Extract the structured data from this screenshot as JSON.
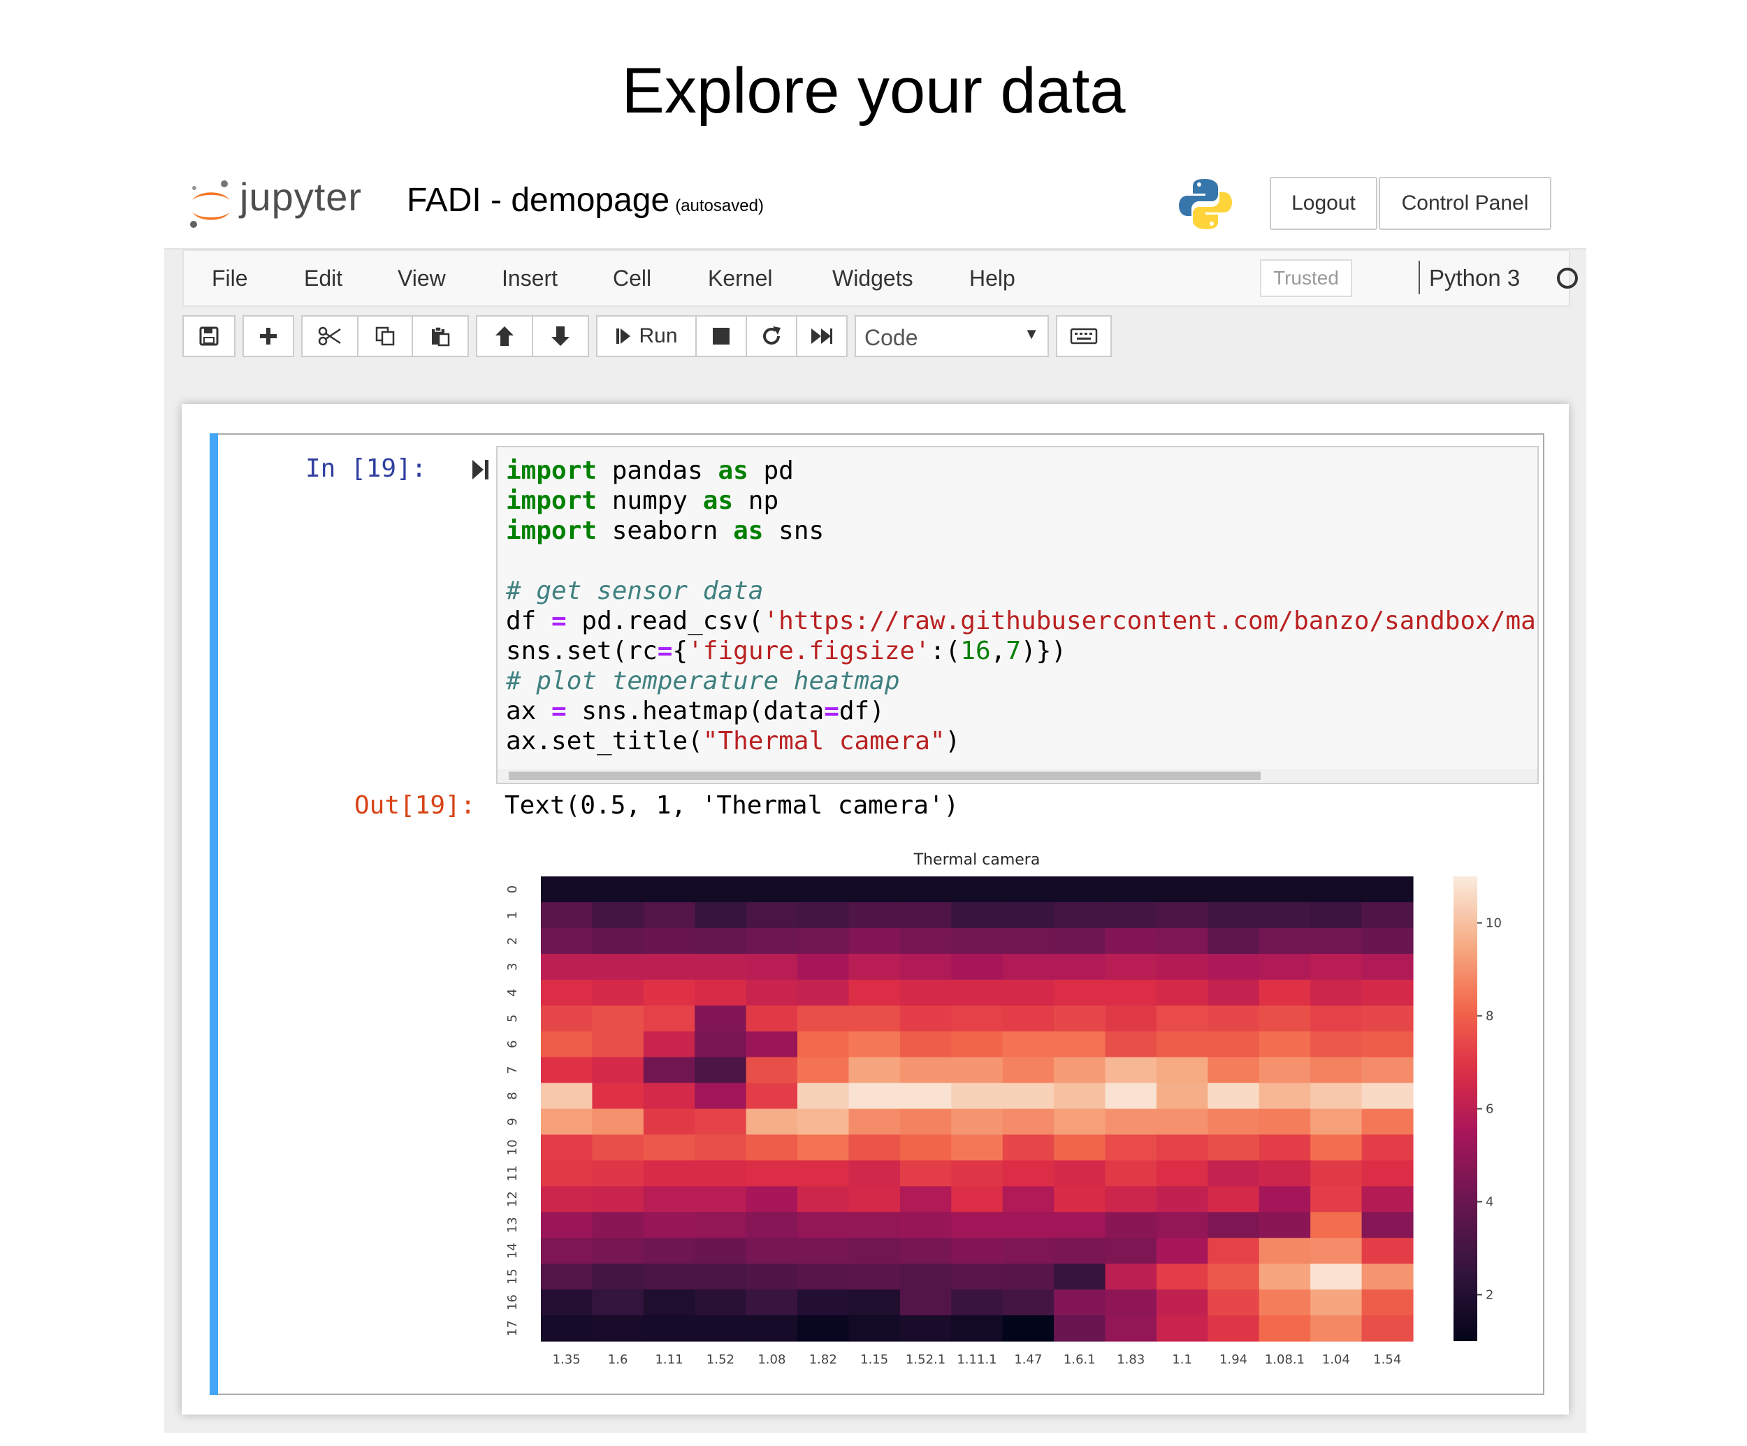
{
  "slide_title": "Explore your data",
  "header": {
    "logo_text": "jupyter",
    "notebook_name": "FADI - demopage",
    "autosave_status": "(autosaved)",
    "logout_label": "Logout",
    "control_panel_label": "Control Panel"
  },
  "menubar": {
    "items": [
      "File",
      "Edit",
      "View",
      "Insert",
      "Cell",
      "Kernel",
      "Widgets",
      "Help"
    ],
    "trusted_label": "Trusted",
    "kernel_name": "Python 3"
  },
  "toolbar": {
    "run_label": "Run",
    "cell_type": "Code"
  },
  "cell": {
    "in_prompt": "In [19]:",
    "out_prompt": "Out[19]:",
    "output_text": "Text(0.5, 1, 'Thermal camera')",
    "code": {
      "l1_kw": "import",
      "l1_mod": " pandas ",
      "l1_as": "as",
      "l1_alias": " pd",
      "l2_kw": "import",
      "l2_mod": " numpy ",
      "l2_as": "as",
      "l2_alias": " np",
      "l3_kw": "import",
      "l3_mod": " seaborn ",
      "l3_as": "as",
      "l3_alias": " sns",
      "c1": "# get sensor data",
      "l5_a": "df ",
      "l5_op": "=",
      "l5_b": " pd.read_csv(",
      "l5_str": "'https://raw.githubusercontent.com/banzo/sandbox/ma",
      "l6_a": "sns.set(rc",
      "l6_op": "=",
      "l6_b": "{",
      "l6_str": "'figure.figsize'",
      "l6_c": ":(",
      "l6_n1": "16",
      "l6_d": ",",
      "l6_n2": "7",
      "l6_e": ")})",
      "c2": "# plot temperature heatmap",
      "l8_a": "ax ",
      "l8_op": "=",
      "l8_b": " sns.heatmap(data",
      "l8_op2": "=",
      "l8_c": "df)",
      "l9_a": "ax.set_title(",
      "l9_str": "\"Thermal camera\"",
      "l9_b": ")"
    }
  },
  "chart_data": {
    "type": "heatmap",
    "title": "Thermal camera",
    "x_tick_labels": [
      "1.35",
      "1.6",
      "1.11",
      "1.52",
      "1.08",
      "1.82",
      "1.15",
      "1.52.1",
      "1.11.1",
      "1.47",
      "1.6.1",
      "1.83",
      "1.1",
      "1.94",
      "1.08.1",
      "1.04",
      "1.54"
    ],
    "y_tick_labels": [
      "0",
      "1",
      "2",
      "3",
      "4",
      "5",
      "6",
      "7",
      "8",
      "9",
      "10",
      "11",
      "12",
      "13",
      "14",
      "15",
      "16",
      "17"
    ],
    "colorbar_ticks": [
      2,
      4,
      6,
      8,
      10
    ],
    "vmin": 1,
    "vmax": 11,
    "colormap": "rocket",
    "values": [
      [
        1.5,
        1.5,
        1.5,
        1.5,
        1.5,
        1.5,
        1.5,
        1.5,
        1.5,
        1.5,
        1.5,
        1.5,
        1.5,
        1.5,
        1.5,
        1.5,
        1.5
      ],
      [
        3.6,
        3.0,
        3.4,
        2.6,
        3.1,
        3.0,
        3.3,
        3.3,
        2.7,
        2.7,
        3.0,
        3.0,
        3.2,
        2.9,
        2.9,
        2.8,
        3.3
      ],
      [
        4.1,
        3.8,
        4.0,
        3.9,
        4.1,
        4.2,
        4.6,
        4.3,
        4.2,
        4.2,
        4.1,
        4.6,
        4.5,
        3.7,
        4.2,
        4.2,
        4.0
      ],
      [
        6.0,
        6.0,
        6.0,
        6.0,
        5.9,
        5.5,
        5.9,
        5.7,
        5.5,
        5.7,
        5.7,
        5.9,
        5.8,
        5.6,
        5.7,
        5.9,
        5.7
      ],
      [
        6.8,
        6.6,
        6.9,
        6.7,
        6.3,
        6.2,
        6.8,
        6.6,
        6.6,
        6.6,
        6.8,
        6.8,
        6.6,
        6.2,
        6.9,
        6.4,
        6.6
      ],
      [
        7.4,
        7.6,
        7.3,
        4.6,
        7.1,
        7.6,
        7.6,
        7.2,
        7.3,
        7.2,
        7.4,
        7.1,
        7.5,
        7.4,
        7.6,
        7.3,
        7.4
      ],
      [
        7.9,
        7.6,
        6.3,
        4.4,
        5.2,
        8.2,
        8.5,
        7.9,
        8.1,
        8.4,
        8.4,
        7.6,
        7.9,
        7.9,
        8.3,
        7.8,
        7.9
      ],
      [
        6.9,
        6.6,
        4.2,
        3.2,
        7.6,
        8.4,
        9.4,
        9.1,
        9.1,
        8.7,
        9.2,
        9.8,
        9.5,
        8.6,
        9.0,
        8.7,
        8.9
      ],
      [
        10.2,
        6.9,
        6.6,
        5.3,
        7.2,
        10.4,
        10.8,
        10.8,
        10.4,
        10.4,
        10.0,
        10.8,
        9.6,
        10.6,
        9.8,
        10.2,
        10.6
      ],
      [
        9.3,
        9.0,
        7.1,
        7.3,
        9.6,
        9.8,
        8.9,
        8.7,
        9.1,
        8.9,
        9.3,
        9.0,
        9.0,
        8.7,
        8.6,
        9.3,
        8.5
      ],
      [
        7.2,
        7.6,
        7.8,
        7.6,
        7.9,
        8.4,
        7.7,
        8.1,
        8.5,
        7.4,
        8.1,
        7.5,
        7.3,
        7.6,
        7.2,
        8.3,
        7.2
      ],
      [
        7.1,
        7.0,
        6.7,
        6.7,
        6.8,
        6.8,
        6.5,
        7.2,
        7.0,
        6.8,
        6.6,
        7.1,
        6.8,
        6.2,
        6.4,
        7.1,
        6.8
      ],
      [
        6.4,
        6.3,
        5.9,
        5.9,
        5.5,
        6.4,
        6.6,
        5.7,
        6.8,
        5.7,
        6.7,
        6.4,
        6.1,
        6.6,
        5.4,
        7.2,
        5.8
      ],
      [
        5.2,
        4.8,
        5.1,
        5.0,
        4.7,
        5.0,
        5.0,
        5.1,
        5.3,
        5.3,
        5.3,
        4.8,
        5.0,
        4.5,
        4.8,
        8.3,
        4.7
      ],
      [
        4.5,
        4.3,
        4.1,
        4.0,
        4.3,
        4.3,
        4.2,
        4.3,
        4.6,
        4.5,
        4.4,
        4.5,
        5.5,
        7.3,
        8.8,
        8.9,
        7.2
      ],
      [
        3.4,
        3.0,
        3.1,
        3.1,
        3.3,
        3.5,
        3.6,
        3.4,
        3.6,
        3.5,
        2.6,
        6.0,
        7.2,
        7.8,
        9.4,
        10.8,
        9.1
      ],
      [
        2.1,
        2.5,
        1.9,
        2.2,
        2.7,
        2.0,
        1.9,
        3.4,
        2.7,
        3.0,
        4.6,
        4.9,
        6.1,
        7.4,
        8.6,
        9.4,
        7.9
      ],
      [
        1.6,
        1.7,
        1.6,
        1.6,
        1.6,
        1.2,
        1.5,
        1.7,
        1.5,
        1.0,
        4.0,
        5.0,
        6.3,
        7.0,
        8.2,
        8.8,
        7.6
      ]
    ]
  }
}
